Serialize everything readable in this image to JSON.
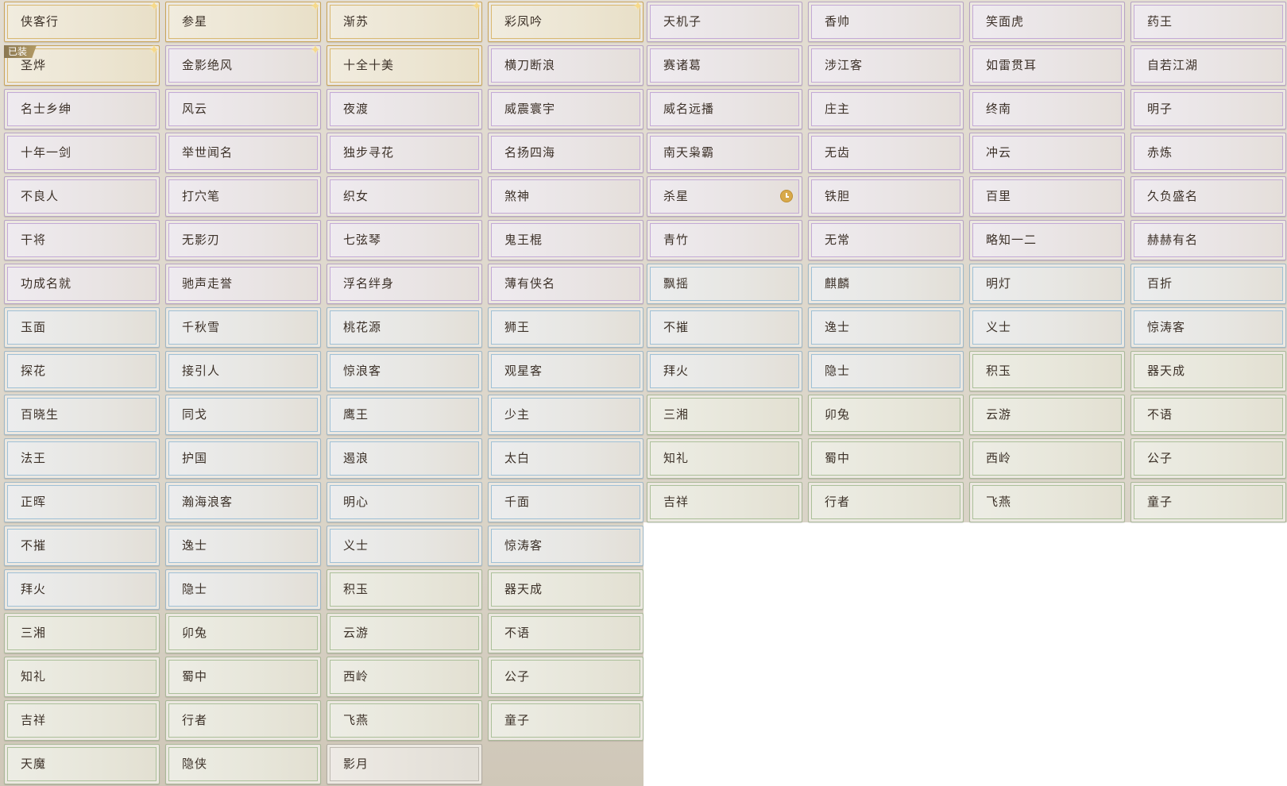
{
  "titles": [
    {
      "label": "侠客行",
      "rarity": "gold",
      "sparkle": true
    },
    {
      "label": "参星",
      "rarity": "gold",
      "sparkle": true
    },
    {
      "label": "渐苏",
      "rarity": "gold",
      "sparkle": true
    },
    {
      "label": "彩凤吟",
      "rarity": "gold",
      "sparkle": true
    },
    {
      "label": "天机子",
      "rarity": "purple"
    },
    {
      "label": "香帅",
      "rarity": "purple"
    },
    {
      "label": "笑面虎",
      "rarity": "purple"
    },
    {
      "label": "药王",
      "rarity": "purple"
    },
    {
      "label": "圣烨",
      "rarity": "gold",
      "sparkle": true,
      "badge": "已装"
    },
    {
      "label": "金影绝风",
      "rarity": "purple",
      "sparkle": true
    },
    {
      "label": "十全十美",
      "rarity": "gold"
    },
    {
      "label": "横刀断浪",
      "rarity": "purple"
    },
    {
      "label": "赛诸葛",
      "rarity": "purple"
    },
    {
      "label": "涉江客",
      "rarity": "purple"
    },
    {
      "label": "如雷贯耳",
      "rarity": "purple"
    },
    {
      "label": "自若江湖",
      "rarity": "purple"
    },
    {
      "label": "名士乡绅",
      "rarity": "purple"
    },
    {
      "label": "风云",
      "rarity": "purple"
    },
    {
      "label": "夜渡",
      "rarity": "purple"
    },
    {
      "label": "威震寰宇",
      "rarity": "purple"
    },
    {
      "label": "威名远播",
      "rarity": "purple"
    },
    {
      "label": "庄主",
      "rarity": "purple"
    },
    {
      "label": "终南",
      "rarity": "purple"
    },
    {
      "label": "明子",
      "rarity": "purple"
    },
    {
      "label": "十年一剑",
      "rarity": "purple"
    },
    {
      "label": "举世闻名",
      "rarity": "purple"
    },
    {
      "label": "独步寻花",
      "rarity": "purple"
    },
    {
      "label": "名扬四海",
      "rarity": "purple"
    },
    {
      "label": "南天枭霸",
      "rarity": "purple"
    },
    {
      "label": "无齿",
      "rarity": "purple"
    },
    {
      "label": "冲云",
      "rarity": "purple"
    },
    {
      "label": "赤炼",
      "rarity": "purple"
    },
    {
      "label": "不良人",
      "rarity": "purple"
    },
    {
      "label": "打穴笔",
      "rarity": "purple"
    },
    {
      "label": "织女",
      "rarity": "purple"
    },
    {
      "label": "煞神",
      "rarity": "purple"
    },
    {
      "label": "杀星",
      "rarity": "purple",
      "timer": true
    },
    {
      "label": "铁胆",
      "rarity": "purple"
    },
    {
      "label": "百里",
      "rarity": "purple"
    },
    {
      "label": "久负盛名",
      "rarity": "purple"
    },
    {
      "label": "干将",
      "rarity": "purple"
    },
    {
      "label": "无影刃",
      "rarity": "purple"
    },
    {
      "label": "七弦琴",
      "rarity": "purple"
    },
    {
      "label": "鬼王棍",
      "rarity": "purple"
    },
    {
      "label": "青竹",
      "rarity": "purple"
    },
    {
      "label": "无常",
      "rarity": "purple"
    },
    {
      "label": "略知一二",
      "rarity": "purple"
    },
    {
      "label": "赫赫有名",
      "rarity": "purple"
    },
    {
      "label": "功成名就",
      "rarity": "purple"
    },
    {
      "label": "驰声走誉",
      "rarity": "purple"
    },
    {
      "label": "浮名绊身",
      "rarity": "purple"
    },
    {
      "label": "薄有侠名",
      "rarity": "purple"
    },
    {
      "label": "飘摇",
      "rarity": "blue"
    },
    {
      "label": "麒麟",
      "rarity": "blue"
    },
    {
      "label": "明灯",
      "rarity": "blue"
    },
    {
      "label": "百折",
      "rarity": "blue"
    },
    {
      "label": "玉面",
      "rarity": "blue"
    },
    {
      "label": "千秋雪",
      "rarity": "blue"
    },
    {
      "label": "桃花源",
      "rarity": "blue"
    },
    {
      "label": "狮王",
      "rarity": "blue"
    },
    {
      "label": "不摧",
      "rarity": "blue"
    },
    {
      "label": "逸士",
      "rarity": "blue"
    },
    {
      "label": "义士",
      "rarity": "blue"
    },
    {
      "label": "惊涛客",
      "rarity": "blue"
    },
    {
      "label": "探花",
      "rarity": "blue"
    },
    {
      "label": "接引人",
      "rarity": "blue"
    },
    {
      "label": "惊浪客",
      "rarity": "blue"
    },
    {
      "label": "观星客",
      "rarity": "blue"
    },
    {
      "label": "拜火",
      "rarity": "blue"
    },
    {
      "label": "隐士",
      "rarity": "blue"
    },
    {
      "label": "积玉",
      "rarity": "green"
    },
    {
      "label": "器天成",
      "rarity": "green"
    },
    {
      "label": "百晓生",
      "rarity": "blue"
    },
    {
      "label": "同戈",
      "rarity": "blue"
    },
    {
      "label": "鹰王",
      "rarity": "blue"
    },
    {
      "label": "少主",
      "rarity": "blue"
    },
    {
      "label": "三湘",
      "rarity": "green"
    },
    {
      "label": "卯兔",
      "rarity": "green"
    },
    {
      "label": "云游",
      "rarity": "green"
    },
    {
      "label": "不语",
      "rarity": "green"
    },
    {
      "label": "法王",
      "rarity": "blue"
    },
    {
      "label": "护国",
      "rarity": "blue"
    },
    {
      "label": "遏浪",
      "rarity": "blue"
    },
    {
      "label": "太白",
      "rarity": "blue"
    },
    {
      "label": "知礼",
      "rarity": "green"
    },
    {
      "label": "蜀中",
      "rarity": "green"
    },
    {
      "label": "西岭",
      "rarity": "green"
    },
    {
      "label": "公子",
      "rarity": "green"
    },
    {
      "label": "正晖",
      "rarity": "blue"
    },
    {
      "label": "瀚海浪客",
      "rarity": "blue"
    },
    {
      "label": "明心",
      "rarity": "blue"
    },
    {
      "label": "千面",
      "rarity": "blue"
    },
    {
      "label": "吉祥",
      "rarity": "green"
    },
    {
      "label": "行者",
      "rarity": "green"
    },
    {
      "label": "飞燕",
      "rarity": "green"
    },
    {
      "label": "童子",
      "rarity": "green"
    },
    {
      "label": "不摧",
      "rarity": "blue"
    },
    {
      "label": "逸士",
      "rarity": "blue"
    },
    {
      "label": "义士",
      "rarity": "blue"
    },
    {
      "label": "惊涛客",
      "rarity": "blue"
    },
    {
      "label": "拜火",
      "rarity": "blue"
    },
    {
      "label": "隐士",
      "rarity": "blue"
    },
    {
      "label": "积玉",
      "rarity": "green"
    },
    {
      "label": "器天成",
      "rarity": "green"
    },
    {
      "label": "三湘",
      "rarity": "green"
    },
    {
      "label": "卯兔",
      "rarity": "green"
    },
    {
      "label": "云游",
      "rarity": "green"
    },
    {
      "label": "不语",
      "rarity": "green"
    },
    {
      "label": "知礼",
      "rarity": "green"
    },
    {
      "label": "蜀中",
      "rarity": "green"
    },
    {
      "label": "西岭",
      "rarity": "green"
    },
    {
      "label": "公子",
      "rarity": "green"
    },
    {
      "label": "吉祥",
      "rarity": "green"
    },
    {
      "label": "行者",
      "rarity": "green"
    },
    {
      "label": "飞燕",
      "rarity": "green"
    },
    {
      "label": "童子",
      "rarity": "green"
    },
    {
      "label": "天魔",
      "rarity": "green"
    },
    {
      "label": "隐侠",
      "rarity": "green"
    },
    {
      "label": "影月",
      "rarity": "gray"
    }
  ],
  "colors": {
    "gold": "#d9b870",
    "purple": "#c3a9d6",
    "blue": "#9fc0d6",
    "green": "#abc09a",
    "gray": "#bdb9b1"
  }
}
